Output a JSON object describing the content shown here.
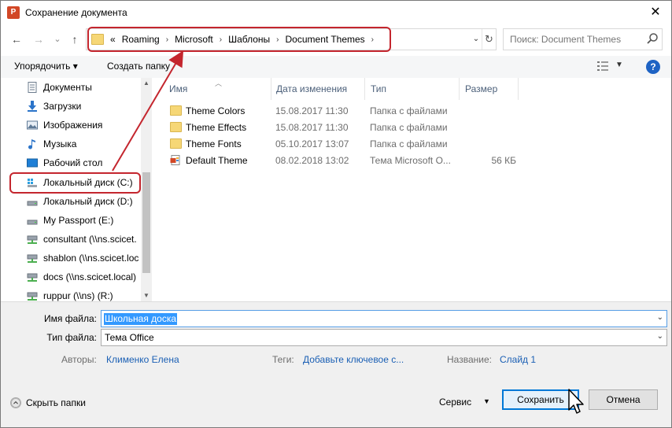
{
  "window": {
    "title": "Сохранение документа",
    "app_icon_letter": "P",
    "close_glyph": "✕"
  },
  "nav": {
    "back": "←",
    "forward": "→",
    "history": "⌄",
    "up": "↑",
    "breadcrumbs": [
      "«",
      "Roaming",
      "Microsoft",
      "Шаблоны",
      "Document Themes"
    ],
    "search_placeholder": "Поиск: Document Themes"
  },
  "toolbar": {
    "organize_label": "Упорядочить ▾",
    "new_folder_label": "Создать папку",
    "help_label": "?"
  },
  "sidebar": {
    "items": [
      {
        "label": "Документы",
        "icon": "documents-icon"
      },
      {
        "label": "Загрузки",
        "icon": "downloads-icon"
      },
      {
        "label": "Изображения",
        "icon": "pictures-icon"
      },
      {
        "label": "Музыка",
        "icon": "music-icon"
      },
      {
        "label": "Рабочий стол",
        "icon": "desktop-icon"
      },
      {
        "label": "Локальный диск (C:)",
        "icon": "system-drive-icon",
        "selected": true
      },
      {
        "label": "Локальный диск (D:)",
        "icon": "drive-icon"
      },
      {
        "label": "My Passport (E:)",
        "icon": "drive-icon"
      },
      {
        "label": "consultant (\\\\ns.scicet.",
        "icon": "network-drive-icon"
      },
      {
        "label": "shablon (\\\\ns.scicet.loc",
        "icon": "network-drive-icon"
      },
      {
        "label": "docs (\\\\ns.scicet.local)",
        "icon": "network-drive-icon"
      },
      {
        "label": "ruppur (\\\\ns) (R:)",
        "icon": "network-drive-icon"
      }
    ]
  },
  "filelist": {
    "columns": [
      "Имя",
      "Дата изменения",
      "Тип",
      "Размер"
    ],
    "rows": [
      {
        "name": "Theme Colors",
        "date": "15.08.2017 11:30",
        "type": "Папка с файлами",
        "size": "",
        "icon": "folder-icon"
      },
      {
        "name": "Theme Effects",
        "date": "15.08.2017 11:30",
        "type": "Папка с файлами",
        "size": "",
        "icon": "folder-icon"
      },
      {
        "name": "Theme Fonts",
        "date": "05.10.2017 13:07",
        "type": "Папка с файлами",
        "size": "",
        "icon": "folder-icon"
      },
      {
        "name": "Default Theme",
        "date": "08.02.2018 13:02",
        "type": "Тема Microsoft O...",
        "size": "56 КБ",
        "icon": "theme-file-icon"
      }
    ]
  },
  "form": {
    "filename_label": "Имя файла:",
    "filename_value": "Школьная доска",
    "filetype_label": "Тип файла:",
    "filetype_value": "Тема Office",
    "authors_label": "Авторы:",
    "authors_value": "Клименко Елена",
    "tags_label": "Теги:",
    "tags_value": "Добавьте ключевое с...",
    "title_label": "Название:",
    "title_value": "Слайд 1"
  },
  "footer": {
    "hide_folders_label": "Скрыть папки",
    "service_label": "Сервис",
    "save_label": "Сохранить",
    "cancel_label": "Отмена"
  },
  "colors": {
    "annotation_red": "#c4262e",
    "selection_blue": "#cce8ff",
    "link_blue": "#1a5fb4",
    "primary_border": "#0078d7"
  }
}
